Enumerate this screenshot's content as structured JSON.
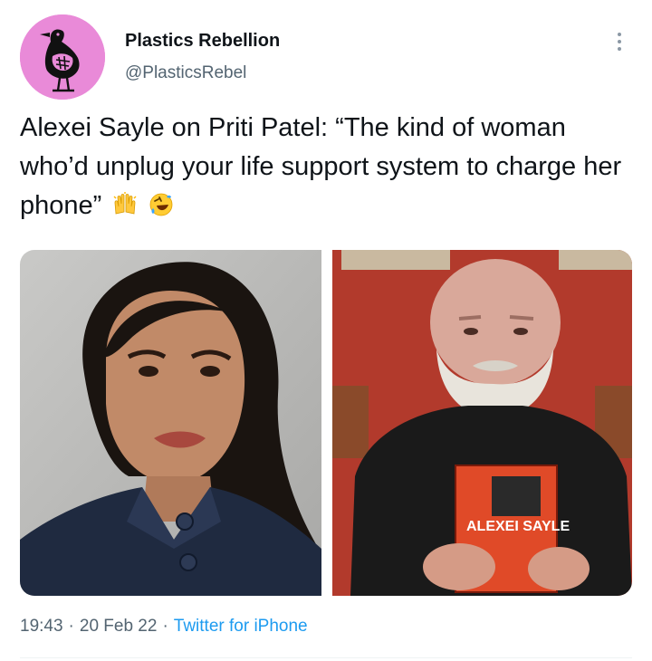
{
  "tweet": {
    "author": {
      "display_name": "Plastics Rebellion",
      "handle": "@PlasticsRebel",
      "avatar_icon": "bird-skeleton-logo",
      "avatar_color": "#e98ad8"
    },
    "more_icon": "more-dots-icon",
    "text": "Alexei Sayle on Priti Patel: “The kind of woman who’d unplug your life support system to charge her phone”",
    "emojis": [
      "raising-hands-emoji",
      "rolling-laughing-emoji"
    ],
    "media": [
      {
        "name": "photo-priti-patel"
      },
      {
        "name": "photo-alexei-sayle",
        "book_title": "ALEXEI SAYLE"
      }
    ],
    "time": "19:43",
    "date": "20 Feb 22",
    "source": "Twitter for iPhone",
    "separator": "·",
    "colors": {
      "text": "#0f1419",
      "secondary": "#536471",
      "link": "#1d9bf0"
    }
  }
}
